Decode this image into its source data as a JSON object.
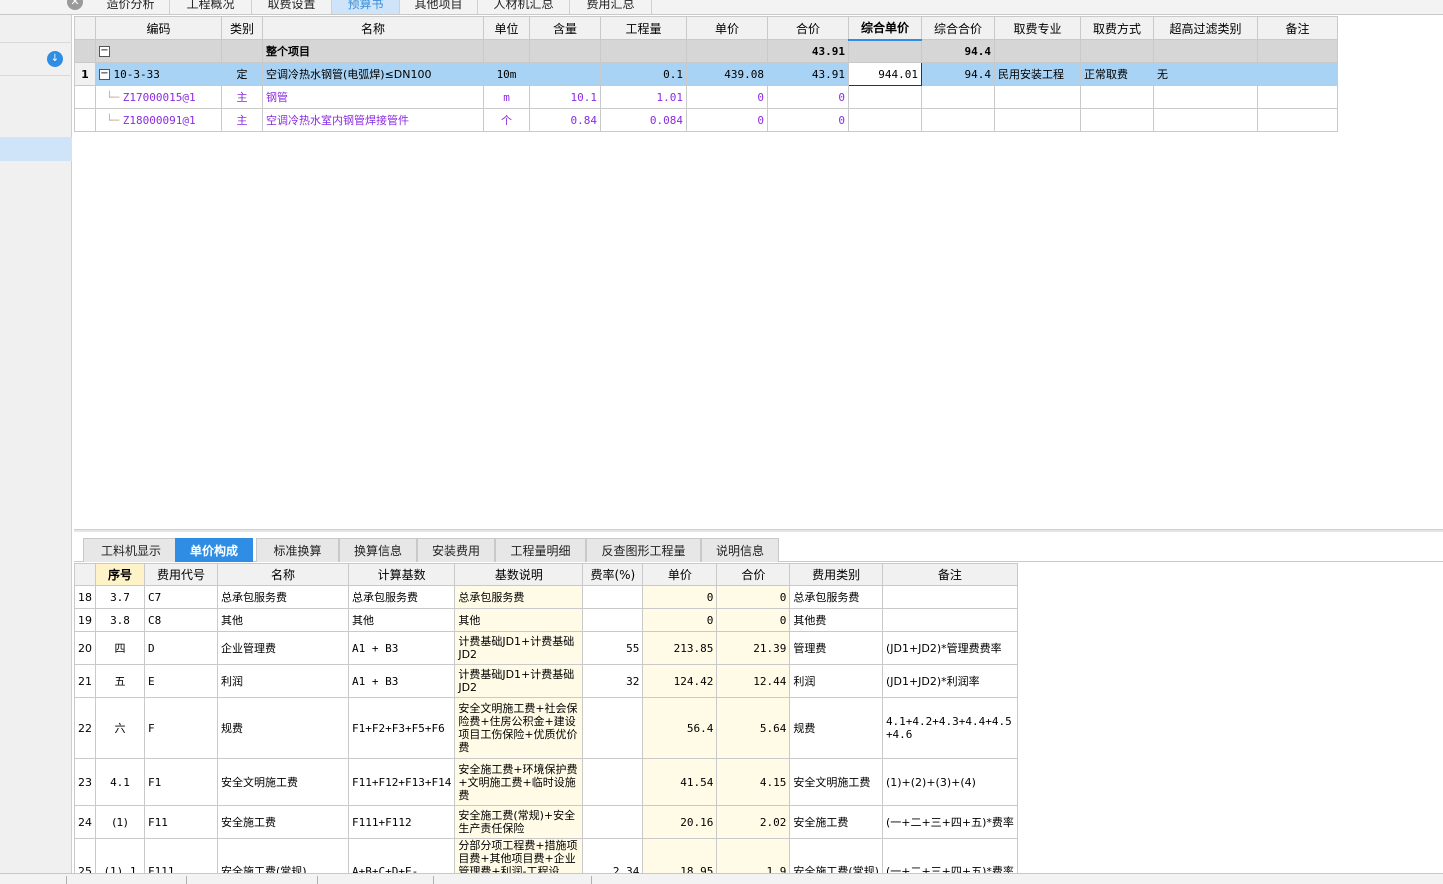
{
  "top_tabs": [
    "造价分析",
    "工程概况",
    "取费设置",
    "预算书",
    "其他项目",
    "人材机汇总",
    "费用汇总"
  ],
  "upper_grid": {
    "headers": [
      "编码",
      "类别",
      "名称",
      "单位",
      "含量",
      "工程量",
      "单价",
      "合价",
      "综合单价",
      "综合合价",
      "取费专业",
      "取费方式",
      "超高过滤类别",
      "备注"
    ],
    "group_row": {
      "name": "整个项目",
      "total": "43.91",
      "composite_total": "94.4"
    },
    "rows": [
      {
        "num": "1",
        "code": "10-3-33",
        "type": "定",
        "name": "空调冷热水钢管(电弧焊)≤DN100",
        "unit": "10m",
        "content": "",
        "quantity": "0.1",
        "unit_price": "439.08",
        "total": "43.91",
        "composite_unit_price": "944.01",
        "composite_total": "94.4",
        "fee_specialty": "民用安装工程",
        "fee_method": "正常取费",
        "filter_type": "无",
        "note": ""
      },
      {
        "num": "",
        "code": "Z17000015@1",
        "type": "主",
        "name": "钢管",
        "unit": "m",
        "content": "10.1",
        "quantity": "1.01",
        "unit_price": "0",
        "total": "0",
        "composite_unit_price": "",
        "composite_total": "",
        "fee_specialty": "",
        "fee_method": "",
        "filter_type": "",
        "note": ""
      },
      {
        "num": "",
        "code": "Z18000091@1",
        "type": "主",
        "name": "空调冷热水室内钢管焊接管件",
        "unit": "个",
        "content": "0.84",
        "quantity": "0.084",
        "unit_price": "0",
        "total": "0",
        "composite_unit_price": "",
        "composite_total": "",
        "fee_specialty": "",
        "fee_method": "",
        "filter_type": "",
        "note": ""
      }
    ]
  },
  "lower_tabs": [
    "工料机显示",
    "单价构成",
    "标准换算",
    "换算信息",
    "安装费用",
    "工程量明细",
    "反查图形工程量",
    "说明信息"
  ],
  "lower_grid": {
    "headers": [
      "序号",
      "费用代号",
      "名称",
      "计算基数",
      "基数说明",
      "费率(%)",
      "单价",
      "合价",
      "费用类别",
      "备注"
    ],
    "rows": [
      {
        "rn": "18",
        "seq": "3.7",
        "code": "C7",
        "name": "总承包服务费",
        "base": "总承包服务费",
        "base_desc": "总承包服务费",
        "rate": "",
        "unit_price": "0",
        "total": "0",
        "category": "总承包服务费",
        "note": ""
      },
      {
        "rn": "19",
        "seq": "3.8",
        "code": "C8",
        "name": "其他",
        "base": "其他",
        "base_desc": "其他",
        "rate": "",
        "unit_price": "0",
        "total": "0",
        "category": "其他费",
        "note": ""
      },
      {
        "rn": "20",
        "seq": "四",
        "code": "D",
        "name": "企业管理费",
        "base": "A1 + B3",
        "base_desc": "计费基础JD1+计费基础JD2",
        "rate": "55",
        "unit_price": "213.85",
        "total": "21.39",
        "category": "管理费",
        "note": "(JD1+JD2)*管理费费率"
      },
      {
        "rn": "21",
        "seq": "五",
        "code": "E",
        "name": "利润",
        "base": "A1 + B3",
        "base_desc": "计费基础JD1+计费基础JD2",
        "rate": "32",
        "unit_price": "124.42",
        "total": "12.44",
        "category": "利润",
        "note": "(JD1+JD2)*利润率"
      },
      {
        "rn": "22",
        "seq": "六",
        "code": "F",
        "name": "规费",
        "base": "F1+F2+F3+F5+F6",
        "base_desc": "安全文明施工费+社会保险费+住房公积金+建设项目工伤保险+优质优价费",
        "rate": "",
        "unit_price": "56.4",
        "total": "5.64",
        "category": "规费",
        "note": "4.1+4.2+4.3+4.4+4.5+4.6"
      },
      {
        "rn": "23",
        "seq": "4.1",
        "code": "F1",
        "name": "安全文明施工费",
        "base": "F11+F12+F13+F14",
        "base_desc": "安全施工费+环境保护费+文明施工费+临时设施费",
        "rate": "",
        "unit_price": "41.54",
        "total": "4.15",
        "category": "安全文明施工费",
        "note": "(1)+(2)+(3)+(4)"
      },
      {
        "rn": "24",
        "seq": "(1)",
        "code": "F11",
        "name": "安全施工费",
        "base": "F111+F112",
        "base_desc": "安全施工费(常规)+安全生产责任保险",
        "rate": "",
        "unit_price": "20.16",
        "total": "2.02",
        "category": "安全施工费",
        "note": "(一+二+三+四+五)*费率"
      },
      {
        "rn": "25",
        "seq": "(1).1",
        "code": "F111",
        "name": "安全施工费(常规)",
        "base": "A+B+C+D+E-",
        "base_desc": "分部分项工程费+措施项目费+其他项目费+企业管理费+利润-工程设",
        "rate": "2.34",
        "unit_price": "18.95",
        "total": "1.9",
        "category": "安全施工费(常规)",
        "note": "(一+二+三+四+五)*费率"
      }
    ]
  }
}
